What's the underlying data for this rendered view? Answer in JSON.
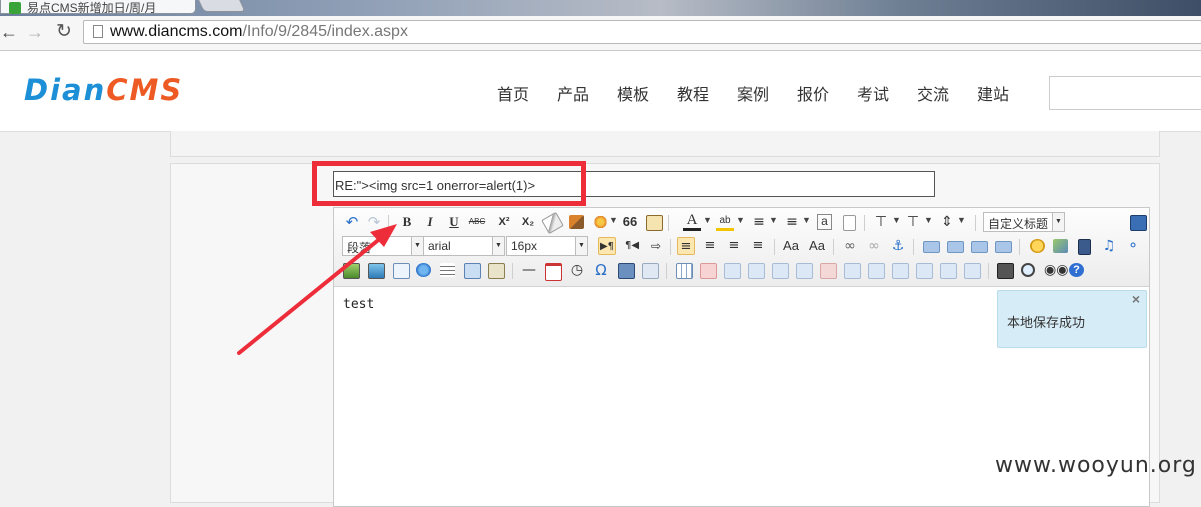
{
  "browser": {
    "tab_title": "易点CMS新增加日/周/月",
    "url_domain": "www.diancms.com",
    "url_path": "/Info/9/2845/index.aspx",
    "icons": {
      "back": "back-arrow-icon",
      "forward": "forward-arrow-icon",
      "reload": "reload-icon",
      "page": "page-icon"
    }
  },
  "site": {
    "logo_part1": "Dian",
    "logo_part2": "CMS",
    "nav": [
      "首页",
      "产品",
      "模板",
      "教程",
      "案例",
      "报价",
      "考试",
      "交流",
      "建站"
    ],
    "search_value": ""
  },
  "reply": {
    "title_value": "RE:\"><img src=1 onerror=alert(1)>"
  },
  "editor": {
    "paragraph_format": "段落",
    "font_family": "arial",
    "font_size": "16px",
    "custom_title": "自定义标题",
    "content": "test",
    "notice_text": "本地保存成功",
    "notice_close": "×",
    "toolbar_row1": [
      "undo",
      "redo",
      "bold",
      "italic",
      "underline",
      "strikethrough",
      "superscript",
      "subscript",
      "eraser",
      "format-brush",
      "auto-format",
      "blockquote",
      "paste-text",
      "font-color",
      "highlight",
      "ordered-list",
      "unordered-list",
      "select-all",
      "clear-doc",
      "row-spacing-top",
      "row-spacing-bottom",
      "line-height",
      "fullscreen"
    ],
    "labels": {
      "bold": "B",
      "italic": "I",
      "underline": "U",
      "strike": "ABC",
      "sup": "X²",
      "sub": "X₂",
      "quote": "66",
      "font_color": "A",
      "omega": "Ω"
    },
    "accent_color": "#1c8fd6",
    "highlight_color": "#ed2d3a"
  },
  "watermark": "www.wooyun.org"
}
